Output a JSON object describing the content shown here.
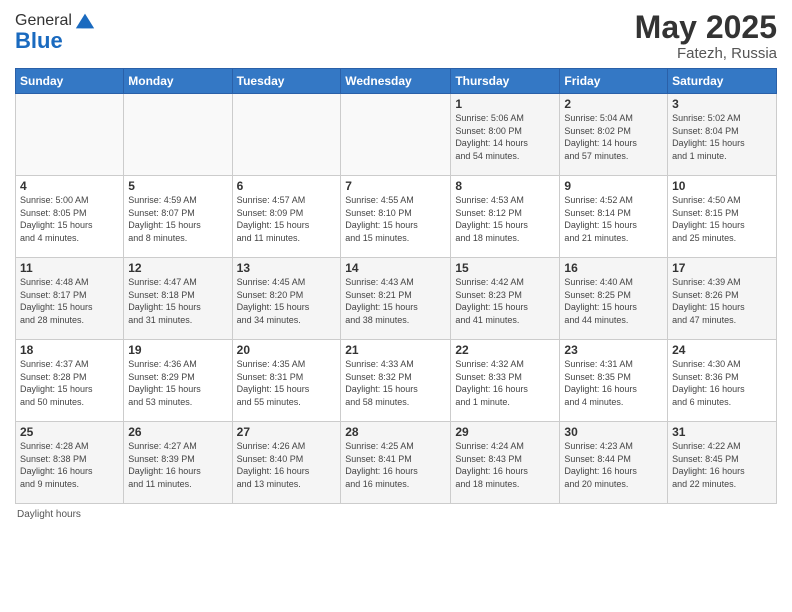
{
  "logo": {
    "general": "General",
    "blue": "Blue"
  },
  "title": {
    "month": "May 2025",
    "location": "Fatezh, Russia"
  },
  "header_days": [
    "Sunday",
    "Monday",
    "Tuesday",
    "Wednesday",
    "Thursday",
    "Friday",
    "Saturday"
  ],
  "weeks": [
    [
      {
        "day": "",
        "info": ""
      },
      {
        "day": "",
        "info": ""
      },
      {
        "day": "",
        "info": ""
      },
      {
        "day": "",
        "info": ""
      },
      {
        "day": "1",
        "info": "Sunrise: 5:06 AM\nSunset: 8:00 PM\nDaylight: 14 hours\nand 54 minutes."
      },
      {
        "day": "2",
        "info": "Sunrise: 5:04 AM\nSunset: 8:02 PM\nDaylight: 14 hours\nand 57 minutes."
      },
      {
        "day": "3",
        "info": "Sunrise: 5:02 AM\nSunset: 8:04 PM\nDaylight: 15 hours\nand 1 minute."
      }
    ],
    [
      {
        "day": "4",
        "info": "Sunrise: 5:00 AM\nSunset: 8:05 PM\nDaylight: 15 hours\nand 4 minutes."
      },
      {
        "day": "5",
        "info": "Sunrise: 4:59 AM\nSunset: 8:07 PM\nDaylight: 15 hours\nand 8 minutes."
      },
      {
        "day": "6",
        "info": "Sunrise: 4:57 AM\nSunset: 8:09 PM\nDaylight: 15 hours\nand 11 minutes."
      },
      {
        "day": "7",
        "info": "Sunrise: 4:55 AM\nSunset: 8:10 PM\nDaylight: 15 hours\nand 15 minutes."
      },
      {
        "day": "8",
        "info": "Sunrise: 4:53 AM\nSunset: 8:12 PM\nDaylight: 15 hours\nand 18 minutes."
      },
      {
        "day": "9",
        "info": "Sunrise: 4:52 AM\nSunset: 8:14 PM\nDaylight: 15 hours\nand 21 minutes."
      },
      {
        "day": "10",
        "info": "Sunrise: 4:50 AM\nSunset: 8:15 PM\nDaylight: 15 hours\nand 25 minutes."
      }
    ],
    [
      {
        "day": "11",
        "info": "Sunrise: 4:48 AM\nSunset: 8:17 PM\nDaylight: 15 hours\nand 28 minutes."
      },
      {
        "day": "12",
        "info": "Sunrise: 4:47 AM\nSunset: 8:18 PM\nDaylight: 15 hours\nand 31 minutes."
      },
      {
        "day": "13",
        "info": "Sunrise: 4:45 AM\nSunset: 8:20 PM\nDaylight: 15 hours\nand 34 minutes."
      },
      {
        "day": "14",
        "info": "Sunrise: 4:43 AM\nSunset: 8:21 PM\nDaylight: 15 hours\nand 38 minutes."
      },
      {
        "day": "15",
        "info": "Sunrise: 4:42 AM\nSunset: 8:23 PM\nDaylight: 15 hours\nand 41 minutes."
      },
      {
        "day": "16",
        "info": "Sunrise: 4:40 AM\nSunset: 8:25 PM\nDaylight: 15 hours\nand 44 minutes."
      },
      {
        "day": "17",
        "info": "Sunrise: 4:39 AM\nSunset: 8:26 PM\nDaylight: 15 hours\nand 47 minutes."
      }
    ],
    [
      {
        "day": "18",
        "info": "Sunrise: 4:37 AM\nSunset: 8:28 PM\nDaylight: 15 hours\nand 50 minutes."
      },
      {
        "day": "19",
        "info": "Sunrise: 4:36 AM\nSunset: 8:29 PM\nDaylight: 15 hours\nand 53 minutes."
      },
      {
        "day": "20",
        "info": "Sunrise: 4:35 AM\nSunset: 8:31 PM\nDaylight: 15 hours\nand 55 minutes."
      },
      {
        "day": "21",
        "info": "Sunrise: 4:33 AM\nSunset: 8:32 PM\nDaylight: 15 hours\nand 58 minutes."
      },
      {
        "day": "22",
        "info": "Sunrise: 4:32 AM\nSunset: 8:33 PM\nDaylight: 16 hours\nand 1 minute."
      },
      {
        "day": "23",
        "info": "Sunrise: 4:31 AM\nSunset: 8:35 PM\nDaylight: 16 hours\nand 4 minutes."
      },
      {
        "day": "24",
        "info": "Sunrise: 4:30 AM\nSunset: 8:36 PM\nDaylight: 16 hours\nand 6 minutes."
      }
    ],
    [
      {
        "day": "25",
        "info": "Sunrise: 4:28 AM\nSunset: 8:38 PM\nDaylight: 16 hours\nand 9 minutes."
      },
      {
        "day": "26",
        "info": "Sunrise: 4:27 AM\nSunset: 8:39 PM\nDaylight: 16 hours\nand 11 minutes."
      },
      {
        "day": "27",
        "info": "Sunrise: 4:26 AM\nSunset: 8:40 PM\nDaylight: 16 hours\nand 13 minutes."
      },
      {
        "day": "28",
        "info": "Sunrise: 4:25 AM\nSunset: 8:41 PM\nDaylight: 16 hours\nand 16 minutes."
      },
      {
        "day": "29",
        "info": "Sunrise: 4:24 AM\nSunset: 8:43 PM\nDaylight: 16 hours\nand 18 minutes."
      },
      {
        "day": "30",
        "info": "Sunrise: 4:23 AM\nSunset: 8:44 PM\nDaylight: 16 hours\nand 20 minutes."
      },
      {
        "day": "31",
        "info": "Sunrise: 4:22 AM\nSunset: 8:45 PM\nDaylight: 16 hours\nand 22 minutes."
      }
    ]
  ],
  "footer": {
    "note": "Daylight hours"
  }
}
